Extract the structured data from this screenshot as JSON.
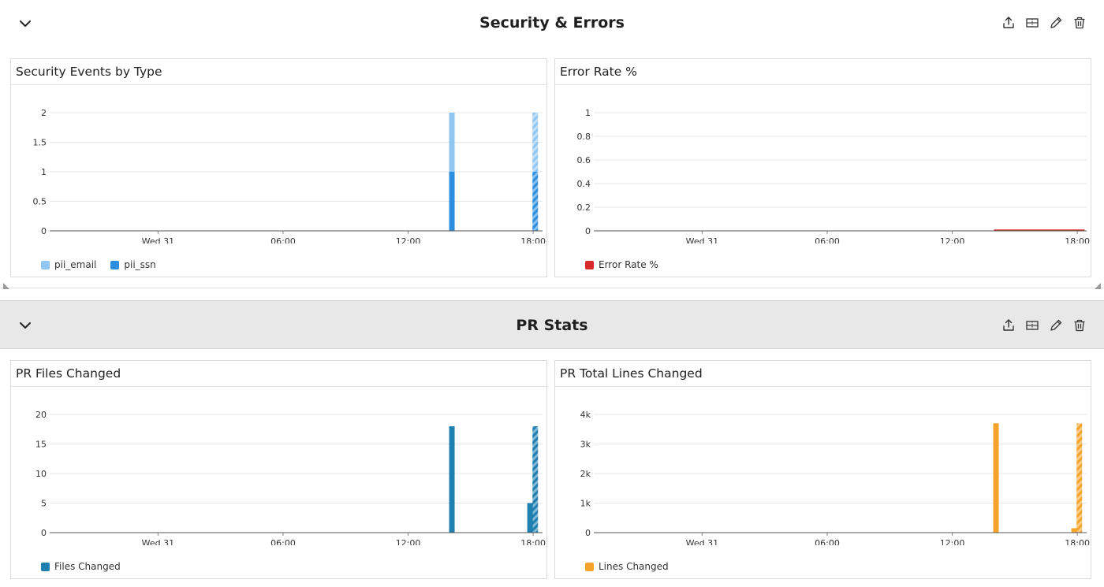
{
  "sections": [
    {
      "title": "Security & Errors",
      "panels": [
        {
          "title": "Security Events by Type",
          "legend": [
            {
              "label": "pii_email",
              "color": "#8fc6f2"
            },
            {
              "label": "pii_ssn",
              "color": "#2b8ede"
            }
          ]
        },
        {
          "title": "Error Rate %",
          "legend": [
            {
              "label": "Error Rate %",
              "color": "#d52b2b"
            }
          ]
        }
      ]
    },
    {
      "title": "PR Stats",
      "panels": [
        {
          "title": "PR Files Changed",
          "legend": [
            {
              "label": "Files Changed",
              "color": "#1f7fb0"
            }
          ]
        },
        {
          "title": "PR Total Lines Changed",
          "legend": [
            {
              "label": "Lines Changed",
              "color": "#f6a32b"
            }
          ]
        }
      ]
    }
  ],
  "icons": [
    "chevron-down-icon",
    "export-icon",
    "layout-icon",
    "edit-icon",
    "trash-icon"
  ],
  "chart_data": [
    {
      "type": "bar",
      "title": "Security Events by Type",
      "x_range_hours": [
        -5.2,
        18.45
      ],
      "x_ticks": [
        {
          "hour": 0,
          "label": "Wed 31"
        },
        {
          "hour": 6,
          "label": "06:00"
        },
        {
          "hour": 12,
          "label": "12:00"
        },
        {
          "hour": 18,
          "label": "18:00"
        }
      ],
      "ylim": [
        0,
        2
      ],
      "y_ticks": [
        {
          "v": 0,
          "label": "0"
        },
        {
          "v": 0.5,
          "label": "0.5"
        },
        {
          "v": 1,
          "label": "1"
        },
        {
          "v": 1.5,
          "label": "1.5"
        },
        {
          "v": 2,
          "label": "2"
        }
      ],
      "stacked": true,
      "series": [
        {
          "name": "pii_ssn",
          "color": "#2b8ede",
          "points": [
            {
              "x": 14.1,
              "y": 1
            },
            {
              "x": 18.1,
              "y": 1,
              "partial": true
            }
          ]
        },
        {
          "name": "pii_email",
          "color": "#8fc6f2",
          "points": [
            {
              "x": 14.1,
              "y": 1
            },
            {
              "x": 18.1,
              "y": 1,
              "partial": true
            }
          ]
        }
      ],
      "grid": true,
      "legend_position": "bottom-left"
    },
    {
      "type": "line",
      "title": "Error Rate %",
      "x_range_hours": [
        -5.2,
        18.45
      ],
      "x_ticks": [
        {
          "hour": 0,
          "label": "Wed 31"
        },
        {
          "hour": 6,
          "label": "06:00"
        },
        {
          "hour": 12,
          "label": "12:00"
        },
        {
          "hour": 18,
          "label": "18:00"
        }
      ],
      "ylim": [
        0,
        1
      ],
      "y_ticks": [
        {
          "v": 0,
          "label": "0"
        },
        {
          "v": 0.2,
          "label": "0.2"
        },
        {
          "v": 0.4,
          "label": "0.4"
        },
        {
          "v": 0.6,
          "label": "0.6"
        },
        {
          "v": 0.8,
          "label": "0.8"
        },
        {
          "v": 1,
          "label": "1"
        }
      ],
      "series": [
        {
          "name": "Error Rate %",
          "color": "#d52b2b",
          "points": [
            {
              "x": 14.0,
              "y": 0
            },
            {
              "x": 18.35,
              "y": 0
            }
          ]
        }
      ],
      "grid": true,
      "legend_position": "bottom-left"
    },
    {
      "type": "bar",
      "title": "PR Files Changed",
      "x_range_hours": [
        -5.2,
        18.45
      ],
      "x_ticks": [
        {
          "hour": 0,
          "label": "Wed 31"
        },
        {
          "hour": 6,
          "label": "06:00"
        },
        {
          "hour": 12,
          "label": "12:00"
        },
        {
          "hour": 18,
          "label": "18:00"
        }
      ],
      "ylim": [
        0,
        20
      ],
      "y_ticks": [
        {
          "v": 0,
          "label": "0"
        },
        {
          "v": 5,
          "label": "5"
        },
        {
          "v": 10,
          "label": "10"
        },
        {
          "v": 15,
          "label": "15"
        },
        {
          "v": 20,
          "label": "20"
        }
      ],
      "series": [
        {
          "name": "Files Changed",
          "color": "#1f7fb0",
          "points": [
            {
              "x": 14.1,
              "y": 18
            },
            {
              "x": 17.85,
              "y": 5
            },
            {
              "x": 18.1,
              "y": 18,
              "partial": true
            }
          ]
        }
      ],
      "grid": true,
      "legend_position": "bottom-left"
    },
    {
      "type": "bar",
      "title": "PR Total Lines Changed",
      "x_range_hours": [
        -5.2,
        18.45
      ],
      "x_ticks": [
        {
          "hour": 0,
          "label": "Wed 31"
        },
        {
          "hour": 6,
          "label": "06:00"
        },
        {
          "hour": 12,
          "label": "12:00"
        },
        {
          "hour": 18,
          "label": "18:00"
        }
      ],
      "ylim": [
        0,
        4000
      ],
      "y_ticks": [
        {
          "v": 0,
          "label": "0"
        },
        {
          "v": 1000,
          "label": "1k"
        },
        {
          "v": 2000,
          "label": "2k"
        },
        {
          "v": 3000,
          "label": "3k"
        },
        {
          "v": 4000,
          "label": "4k"
        }
      ],
      "series": [
        {
          "name": "Lines Changed",
          "color": "#f6a32b",
          "points": [
            {
              "x": 14.1,
              "y": 3700
            },
            {
              "x": 17.85,
              "y": 150
            },
            {
              "x": 18.1,
              "y": 3700,
              "partial": true
            }
          ]
        }
      ],
      "grid": true,
      "legend_position": "bottom-left"
    }
  ]
}
